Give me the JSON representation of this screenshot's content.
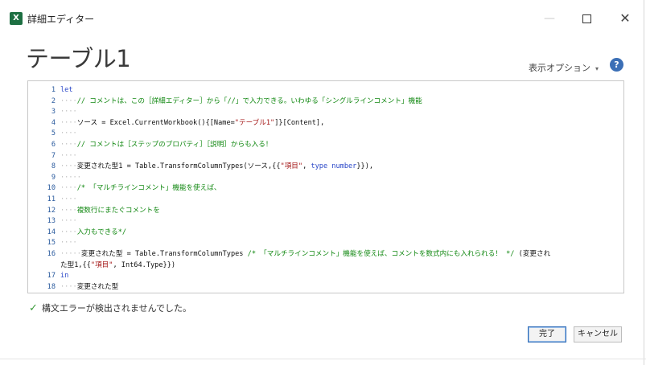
{
  "window": {
    "icon_text": "X",
    "title": "詳細エディター",
    "minimize": "—",
    "close": "✕"
  },
  "heading": "テーブル1",
  "view_options": {
    "label": "表示オプション",
    "chevron": "▾"
  },
  "help": "?",
  "code_lines": [
    {
      "n": "1",
      "parts": [
        [
          "kw",
          "let"
        ]
      ]
    },
    {
      "n": "2",
      "parts": [
        [
          "indent",
          "····"
        ],
        [
          "cm",
          "// コメントは、この［詳細エディター］から「//」で入力できる。いわゆる「シングルラインコメント」機能"
        ]
      ]
    },
    {
      "n": "3",
      "parts": [
        [
          "indent",
          "····"
        ]
      ]
    },
    {
      "n": "4",
      "parts": [
        [
          "indent",
          "····"
        ],
        [
          "t",
          "ソース = Excel.CurrentWorkbook(){[Name="
        ],
        [
          "str",
          "\"テーブル1\""
        ],
        [
          "t",
          "]}[Content],"
        ]
      ]
    },
    {
      "n": "5",
      "parts": [
        [
          "indent",
          "····"
        ]
      ]
    },
    {
      "n": "6",
      "parts": [
        [
          "indent",
          "····"
        ],
        [
          "cm",
          "// コメントは［ステップのプロパティ］［説明］からも入る！"
        ]
      ]
    },
    {
      "n": "7",
      "parts": [
        [
          "indent",
          "····"
        ]
      ]
    },
    {
      "n": "8",
      "parts": [
        [
          "indent",
          "····"
        ],
        [
          "t",
          "変更された型1 = Table.TransformColumnTypes(ソース,{{"
        ],
        [
          "str",
          "\"項目\""
        ],
        [
          "t",
          ", "
        ],
        [
          "kw",
          "type number"
        ],
        [
          "t",
          "}}),"
        ]
      ]
    },
    {
      "n": "9",
      "parts": [
        [
          "indent",
          "·····"
        ]
      ]
    },
    {
      "n": "10",
      "parts": [
        [
          "indent",
          "····"
        ],
        [
          "cm",
          "/* 「マルチラインコメント」機能を使えば、"
        ]
      ]
    },
    {
      "n": "11",
      "parts": [
        [
          "indent",
          "····"
        ]
      ]
    },
    {
      "n": "12",
      "parts": [
        [
          "indent",
          "····"
        ],
        [
          "cm",
          "複数行にまたぐコメントを"
        ]
      ]
    },
    {
      "n": "13",
      "parts": [
        [
          "indent",
          "····"
        ]
      ]
    },
    {
      "n": "14",
      "parts": [
        [
          "indent",
          "····"
        ],
        [
          "cm",
          "入力もできる*/"
        ]
      ]
    },
    {
      "n": "15",
      "parts": [
        [
          "indent",
          "····"
        ]
      ]
    },
    {
      "n": "16",
      "parts": [
        [
          "indent",
          "·····"
        ],
        [
          "t",
          "変更された型 = Table.TransformColumnTypes "
        ],
        [
          "cm",
          "/* 「マルチラインコメント」機能を使えば、コメントを数式内にも入れられる！ */"
        ],
        [
          "t",
          " (変更され"
        ]
      ]
    },
    {
      "n": "",
      "parts": [
        [
          "t",
          "         た型1,{{"
        ],
        [
          "str",
          "\"項目\""
        ],
        [
          "t",
          ", Int64.Type}})"
        ]
      ]
    },
    {
      "n": "17",
      "parts": [
        [
          "kw",
          "in"
        ]
      ]
    },
    {
      "n": "18",
      "parts": [
        [
          "indent",
          "····"
        ],
        [
          "t",
          "変更された型"
        ]
      ]
    }
  ],
  "status": {
    "icon": "✓",
    "text": "構文エラーが検出されませんでした。"
  },
  "buttons": {
    "done": "完了",
    "cancel": "キャンセル"
  }
}
